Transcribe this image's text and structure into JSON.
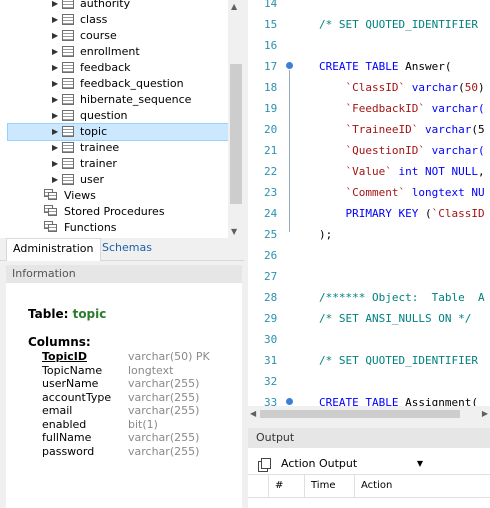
{
  "navigator": {
    "tables": [
      {
        "label": "authority"
      },
      {
        "label": "class"
      },
      {
        "label": "course"
      },
      {
        "label": "enrollment"
      },
      {
        "label": "feedback"
      },
      {
        "label": "feedback_question"
      },
      {
        "label": "hibernate_sequence"
      },
      {
        "label": "question"
      },
      {
        "label": "topic"
      },
      {
        "label": "trainee"
      },
      {
        "label": "trainer"
      },
      {
        "label": "user"
      }
    ],
    "groups": [
      {
        "label": "Views"
      },
      {
        "label": "Stored Procedures"
      },
      {
        "label": "Functions"
      }
    ],
    "tabs": {
      "administration": "Administration",
      "schemas": "Schemas"
    }
  },
  "information": {
    "header": "Information",
    "table_label": "Table:",
    "table_name": "topic",
    "columns_label": "Columns:",
    "columns": [
      {
        "name": "TopicID",
        "type": "varchar(50) PK"
      },
      {
        "name": "TopicName",
        "type": "longtext"
      },
      {
        "name": "userName",
        "type": "varchar(255)"
      },
      {
        "name": "accountType",
        "type": "varchar(255)"
      },
      {
        "name": "email",
        "type": "varchar(255)"
      },
      {
        "name": "enabled",
        "type": "bit(1)"
      },
      {
        "name": "fullName",
        "type": "varchar(255)"
      },
      {
        "name": "password",
        "type": "varchar(255)"
      }
    ]
  },
  "editor": {
    "lines": [
      {
        "num": "14"
      },
      {
        "num": "15",
        "parts": [
          {
            "c": "cm",
            "t": "/* SET QUOTED_IDENTIFIER"
          }
        ]
      },
      {
        "num": "16"
      },
      {
        "num": "17",
        "parts": [
          {
            "c": "kw",
            "t": "CREATE TABLE "
          },
          {
            "c": "pl",
            "t": "Answer("
          }
        ]
      },
      {
        "num": "18",
        "parts": [
          {
            "c": "pl",
            "t": "    "
          },
          {
            "c": "str",
            "t": "`ClassID`"
          },
          {
            "c": "pl",
            "t": " "
          },
          {
            "c": "kw",
            "t": "varchar"
          },
          {
            "c": "pl",
            "t": "("
          },
          {
            "c": "str",
            "t": "50"
          },
          {
            "c": "pl",
            "t": ")"
          }
        ]
      },
      {
        "num": "19",
        "parts": [
          {
            "c": "pl",
            "t": "    "
          },
          {
            "c": "str",
            "t": "`FeedbackID`"
          },
          {
            "c": "pl",
            "t": " "
          },
          {
            "c": "kw",
            "t": "varchar("
          }
        ]
      },
      {
        "num": "20",
        "parts": [
          {
            "c": "pl",
            "t": "    "
          },
          {
            "c": "str",
            "t": "`TraineeID`"
          },
          {
            "c": "pl",
            "t": " "
          },
          {
            "c": "kw",
            "t": "varchar"
          },
          {
            "c": "pl",
            "t": "(5"
          }
        ]
      },
      {
        "num": "21",
        "parts": [
          {
            "c": "pl",
            "t": "    "
          },
          {
            "c": "str",
            "t": "`QuestionID`"
          },
          {
            "c": "pl",
            "t": " "
          },
          {
            "c": "kw",
            "t": "varchar("
          }
        ]
      },
      {
        "num": "22",
        "parts": [
          {
            "c": "pl",
            "t": "    "
          },
          {
            "c": "str",
            "t": "`Value`"
          },
          {
            "c": "pl",
            "t": " "
          },
          {
            "c": "kw",
            "t": "int NOT NULL"
          },
          {
            "c": "pl",
            "t": ","
          }
        ]
      },
      {
        "num": "23",
        "parts": [
          {
            "c": "pl",
            "t": "    "
          },
          {
            "c": "str",
            "t": "`Comment`"
          },
          {
            "c": "pl",
            "t": " "
          },
          {
            "c": "kw",
            "t": "longtext NU"
          }
        ]
      },
      {
        "num": "24",
        "parts": [
          {
            "c": "pl",
            "t": "    "
          },
          {
            "c": "kw",
            "t": "PRIMARY KEY"
          },
          {
            "c": "pl",
            "t": " ("
          },
          {
            "c": "str",
            "t": "`ClassID"
          }
        ]
      },
      {
        "num": "25",
        "parts": [
          {
            "c": "pl",
            "t": ");"
          }
        ]
      },
      {
        "num": "26"
      },
      {
        "num": "27"
      },
      {
        "num": "28",
        "parts": [
          {
            "c": "cm",
            "t": "/****** Object:  Table  A"
          }
        ]
      },
      {
        "num": "29",
        "parts": [
          {
            "c": "cm",
            "t": "/* SET ANSI_NULLS ON */"
          }
        ]
      },
      {
        "num": "30"
      },
      {
        "num": "31",
        "parts": [
          {
            "c": "cm",
            "t": "/* SET QUOTED_IDENTIFIER"
          }
        ]
      },
      {
        "num": "32"
      },
      {
        "num": "33",
        "parts": [
          {
            "c": "kw",
            "t": "CREATE TABLE "
          },
          {
            "c": "pl",
            "t": "Assignment("
          }
        ]
      }
    ]
  },
  "output": {
    "header": "Output",
    "selector": "Action Output",
    "columns": {
      "num": "#",
      "time": "Time",
      "action": "Action"
    }
  }
}
